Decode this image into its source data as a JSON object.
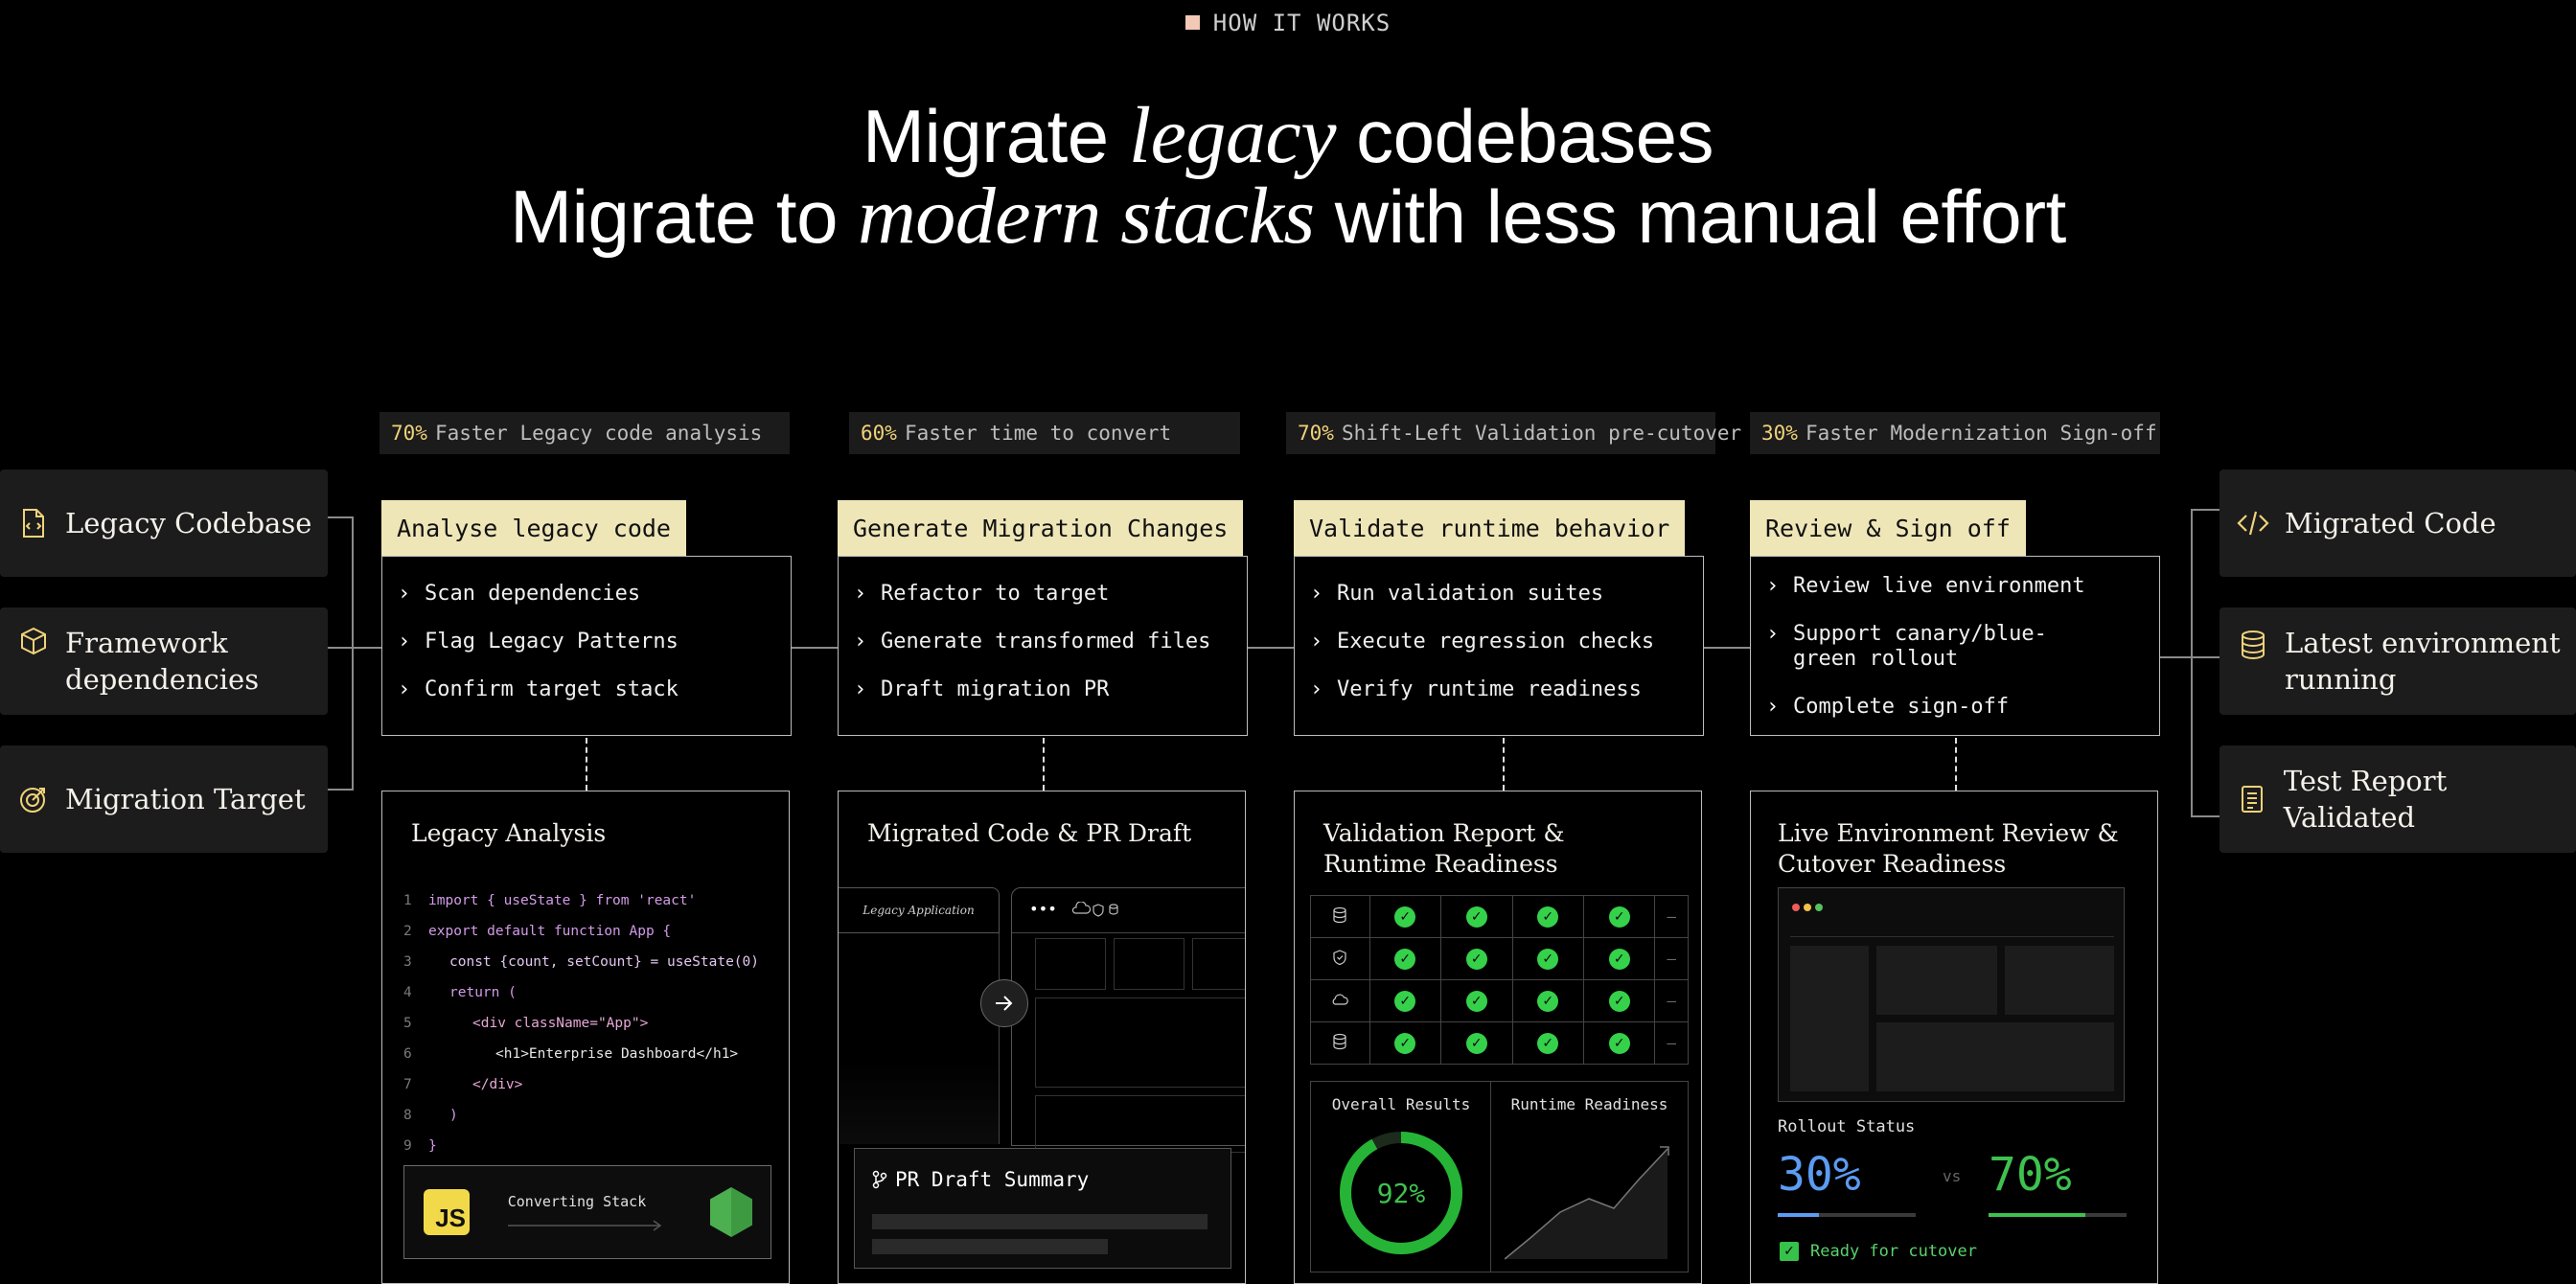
{
  "section_label": "HOW IT WORKS",
  "headline": {
    "line1_pre": "Migrate ",
    "line1_em": "legacy",
    "line1_post": " codebases",
    "line2_pre": "Migrate to ",
    "line2_em": "modern stacks",
    "line2_post": " with less manual effort"
  },
  "inputs": [
    {
      "label": "Legacy Codebase",
      "icon": "file-code-icon"
    },
    {
      "label": "Framework dependencies",
      "icon": "cube-icon"
    },
    {
      "label": "Migration Target",
      "icon": "target-icon"
    }
  ],
  "outputs": [
    {
      "label": "Migrated Code",
      "icon": "code-icon"
    },
    {
      "label": "Latest environment running",
      "icon": "database-icon"
    },
    {
      "label": "Test Report Validated",
      "icon": "report-icon"
    }
  ],
  "stats": [
    {
      "pct": "70%",
      "text": "Faster Legacy code analysis"
    },
    {
      "pct": "60%",
      "text": "Faster time to convert"
    },
    {
      "pct": "70%",
      "text": "Shift-Left Validation pre-cutover"
    },
    {
      "pct": "30%",
      "text": "Faster Modernization Sign-off"
    }
  ],
  "steps": [
    {
      "title": "Analyse legacy code",
      "items": [
        "Scan dependencies",
        "Flag Legacy Patterns",
        "Confirm target stack"
      ]
    },
    {
      "title": "Generate Migration Changes",
      "items": [
        "Refactor to target",
        "Generate transformed files",
        "Draft migration PR"
      ]
    },
    {
      "title": "Validate runtime behavior",
      "items": [
        "Run validation suites",
        "Execute regression checks",
        "Verify runtime readiness"
      ]
    },
    {
      "title": "Review & Sign off",
      "items": [
        "Review live environment",
        "Support canary/blue-green rollout",
        "Complete sign-off"
      ]
    }
  ],
  "panels": {
    "analysis": {
      "title": "Legacy Analysis",
      "code": [
        {
          "n": "1",
          "t": "import { useState } from 'react'"
        },
        {
          "n": "2",
          "t": "export default function App {"
        },
        {
          "n": "3",
          "t": "const {count, setCount} = useState(0)"
        },
        {
          "n": "4",
          "t": "return ("
        },
        {
          "n": "5",
          "t": "<div className=\"App\">"
        },
        {
          "n": "6",
          "t": "<h1>Enterprise Dashboard</h1>"
        },
        {
          "n": "7",
          "t": "</div>"
        },
        {
          "n": "8",
          "t": ")"
        },
        {
          "n": "9",
          "t": "}"
        }
      ],
      "converting_label": "Converting Stack",
      "js_badge": "JS"
    },
    "migrated": {
      "title": "Migrated Code & PR Draft",
      "legacy_tab": "Legacy Application",
      "pr_title": "PR Draft Summary"
    },
    "validation": {
      "title_line1": "Validation Report &",
      "title_line2": "Runtime Readiness",
      "overall_label": "Overall Results",
      "overall_value": "92%",
      "overall_fraction": 0.92,
      "runtime_label": "Runtime Readiness",
      "check_glyph": "✓",
      "dash_glyph": "—"
    },
    "review": {
      "title_line1": "Live Environment Review &",
      "title_line2": "Cutover Readiness",
      "rollout_label": "Rollout Status",
      "left_pct": "30%",
      "left_fraction": 0.3,
      "vs": "vs",
      "right_pct": "70%",
      "right_fraction": 0.7,
      "ready_text": "Ready for cutover"
    }
  },
  "colors": {
    "accent_yellow": "#f0d27a",
    "tab_bg": "#efe6b8",
    "check_green": "#35d14a",
    "blue": "#5b9cf2",
    "green": "#3ec14f"
  }
}
